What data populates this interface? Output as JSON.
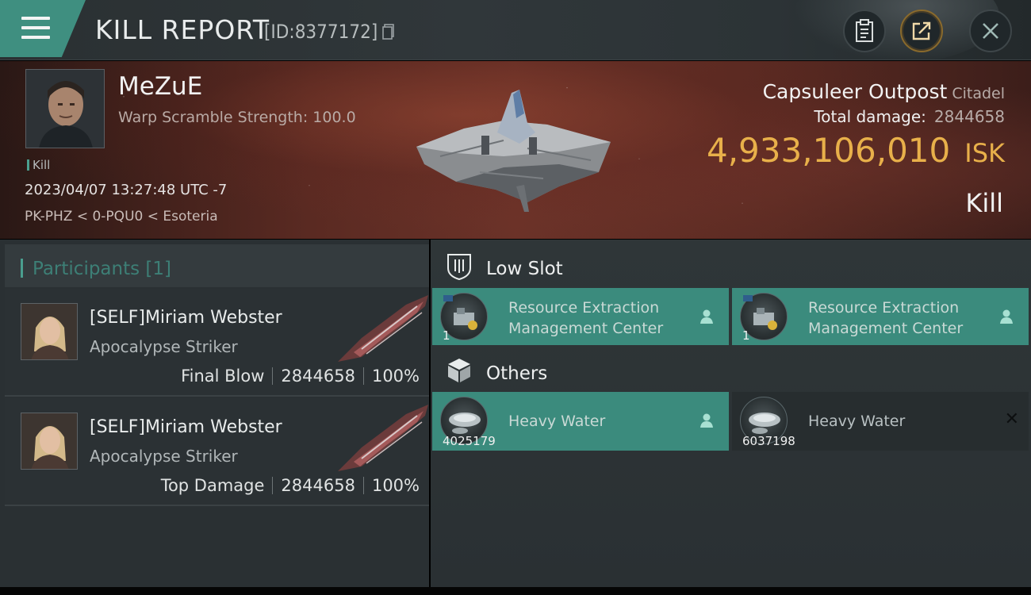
{
  "header": {
    "title": "KILL REPORT",
    "report_id": "[ID:8377172]",
    "menu_icon": "hamburger-menu-icon",
    "actions": [
      {
        "name": "clipboard-icon"
      },
      {
        "name": "share-export-icon"
      },
      {
        "name": "close-icon"
      }
    ]
  },
  "victim": {
    "pilot_name": "MeZuE",
    "warp_scramble": "Warp Scramble Strength: 100.0",
    "tag": "Kill",
    "datetime": "2023/04/07 13:27:48 UTC -7",
    "location": "PK-PHZ < 0-PQU0 < Esoteria",
    "target_name": "Capsuleer Outpost",
    "target_class": "Citadel",
    "total_damage_label": "Total damage:",
    "total_damage_value": "2844658",
    "isk_value": "4,933,106,010",
    "isk_unit": "ISK",
    "result": "Kill"
  },
  "participants": {
    "header": "Participants [1]",
    "rows": [
      {
        "name": "[SELF]Miriam Webster",
        "ship": "Apocalypse Striker",
        "role": "Final Blow",
        "damage": "2844658",
        "percent": "100%"
      },
      {
        "name": "[SELF]Miriam Webster",
        "ship": "Apocalypse Striker",
        "role": "Top Damage",
        "damage": "2844658",
        "percent": "100%"
      }
    ]
  },
  "sections": {
    "low_slot": {
      "label": "Low Slot",
      "icon": "low-slot-icon",
      "items": [
        {
          "line1": "Resource Extraction",
          "line2": "Management Center",
          "qty": "1",
          "state": "destroyed"
        },
        {
          "line1": "Resource Extraction",
          "line2": "Management Center",
          "qty": "1",
          "state": "destroyed"
        }
      ]
    },
    "others": {
      "label": "Others",
      "icon": "cargo-box-icon",
      "items": [
        {
          "line1": "Heavy Water",
          "qty": "4025179",
          "state": "destroyed"
        },
        {
          "line1": "Heavy Water",
          "qty": "6037198",
          "state": "dropped"
        }
      ]
    }
  },
  "colors": {
    "accent_teal": "#3b8b7d",
    "isk_gold": "#e8b04a",
    "hero_red": "#6b3228"
  }
}
